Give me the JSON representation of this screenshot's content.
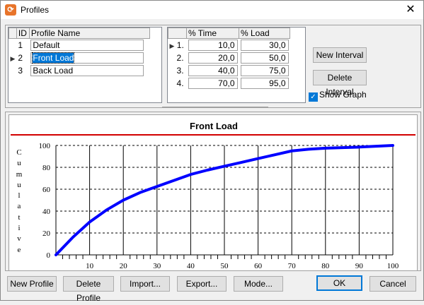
{
  "window": {
    "title": "Profiles",
    "close_glyph": "✕",
    "icon_glyph": "⟳"
  },
  "profiles": {
    "headers": {
      "id": "ID",
      "name": "Profile Name"
    },
    "rows": [
      {
        "id": "1",
        "name": "Default"
      },
      {
        "id": "2",
        "name": "Front Load"
      },
      {
        "id": "3",
        "name": "Back Load"
      }
    ],
    "selected_index": 1
  },
  "intervals": {
    "headers": {
      "time": "% Time",
      "load": "% Load"
    },
    "rows": [
      {
        "idx": "1.",
        "time": "10,0",
        "load": "30,0"
      },
      {
        "idx": "2.",
        "time": "20,0",
        "load": "50,0"
      },
      {
        "idx": "3.",
        "time": "40,0",
        "load": "75,0"
      },
      {
        "idx": "4.",
        "time": "70,0",
        "load": "95,0"
      }
    ]
  },
  "buttons": {
    "new_interval": "New Interval",
    "delete_interval": "Delete Interval",
    "new_profile": "New Profile",
    "delete_profile": "Delete Profile",
    "import": "Import...",
    "export": "Export...",
    "mode": "Mode...",
    "ok": "OK",
    "cancel": "Cancel"
  },
  "show_graph": {
    "label": "Show Graph",
    "checked": true
  },
  "colors": {
    "series": "#0000ff",
    "title_rule": "#d20000",
    "accent": "#0078d7"
  },
  "chart_data": {
    "type": "line",
    "title": "Front Load",
    "ylabel": "Cumulative",
    "xlim": [
      0,
      100
    ],
    "ylim": [
      0,
      100
    ],
    "x_ticks": [
      10,
      20,
      30,
      40,
      50,
      60,
      70,
      80,
      90,
      100
    ],
    "y_ticks": [
      0,
      20,
      40,
      60,
      80,
      100
    ],
    "grid": true,
    "series": [
      {
        "x": [
          0,
          5,
          10,
          15,
          20,
          25,
          30,
          35,
          40,
          45,
          50,
          55,
          60,
          65,
          70,
          75,
          80,
          85,
          90,
          95,
          100
        ],
        "y": [
          0,
          16,
          30,
          41,
          50,
          57,
          62.5,
          68,
          73.5,
          77.5,
          81,
          84.5,
          88,
          91.5,
          95,
          96.5,
          97.5,
          98,
          98.5,
          99.3,
          100
        ]
      }
    ]
  }
}
